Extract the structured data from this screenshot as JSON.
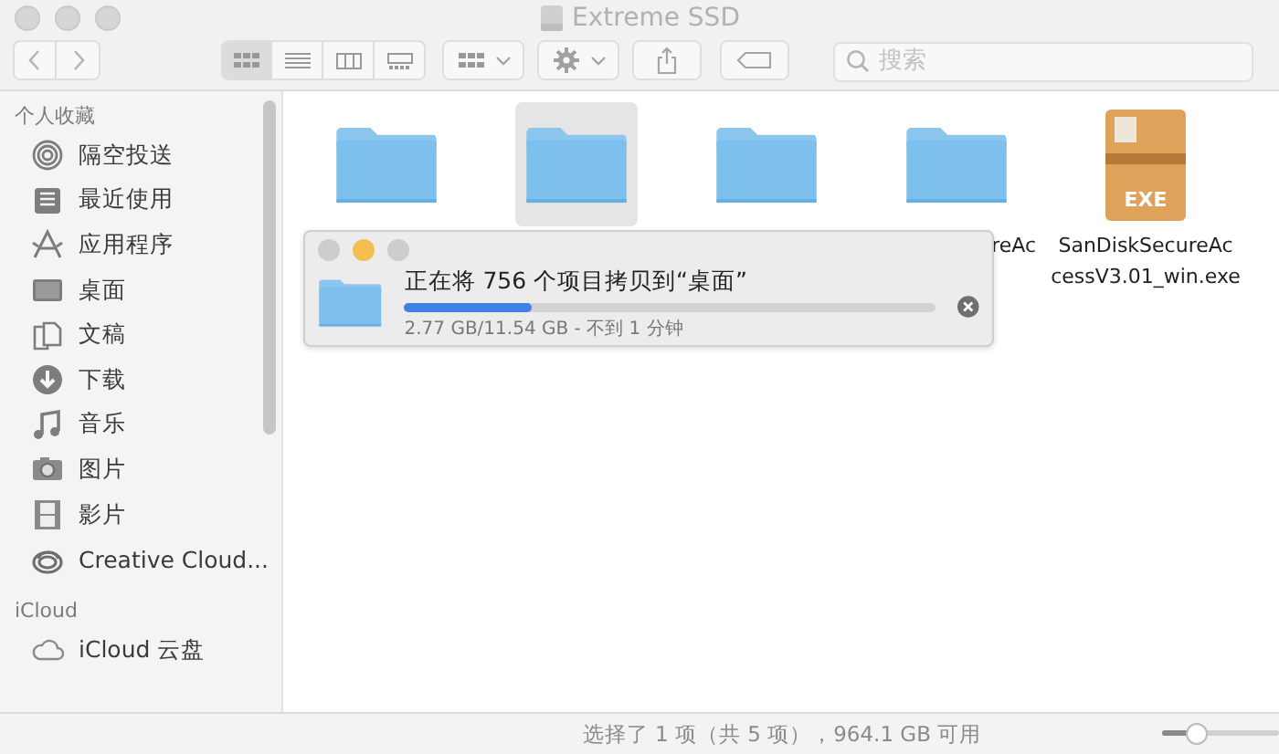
{
  "window": {
    "title": "Extreme SSD"
  },
  "toolbar": {
    "view_buttons": [
      {
        "kind": "icons",
        "selected": true
      },
      {
        "kind": "list",
        "selected": false
      },
      {
        "kind": "columns",
        "selected": false
      },
      {
        "kind": "gallery",
        "selected": false
      }
    ],
    "search": {
      "placeholder": "搜索"
    }
  },
  "sidebar": {
    "sections": [
      {
        "title": "个人收藏",
        "items": [
          {
            "label": "隔空投送",
            "kind": "airdrop"
          },
          {
            "label": "最近使用",
            "kind": "recents"
          },
          {
            "label": "应用程序",
            "kind": "apps"
          },
          {
            "label": "桌面",
            "kind": "desktop"
          },
          {
            "label": "文稿",
            "kind": "documents"
          },
          {
            "label": "下载",
            "kind": "downloads"
          },
          {
            "label": "音乐",
            "kind": "music"
          },
          {
            "label": "图片",
            "kind": "pictures"
          },
          {
            "label": "影片",
            "kind": "movies"
          },
          {
            "label": "Creative Cloud...",
            "kind": "cc"
          }
        ]
      },
      {
        "title": "iCloud",
        "items": [
          {
            "label": "iCloud 云盘",
            "kind": "cloud"
          }
        ]
      }
    ]
  },
  "files": [
    {
      "kind": "folder",
      "selected": false
    },
    {
      "kind": "folder",
      "selected": true
    },
    {
      "kind": "folder",
      "selected": false
    },
    {
      "kind": "folder",
      "selected": false,
      "label_lines": [
        "reAc"
      ]
    },
    {
      "kind": "exe",
      "selected": false,
      "icon_text": "EXE",
      "label_lines": [
        "SanDiskSecureAc",
        "cessV3.01_win.exe"
      ]
    }
  ],
  "copy_dialog": {
    "message": "正在将 756 个项目拷贝到“桌面”",
    "level": 0.24,
    "detail": "2.77 GB/11.54 GB - 不到 1 分钟"
  },
  "status_bar": {
    "text": "选择了 1 项（共 5 项），964.1 GB 可用",
    "icon_size_slider": {
      "level": 0.3
    }
  }
}
